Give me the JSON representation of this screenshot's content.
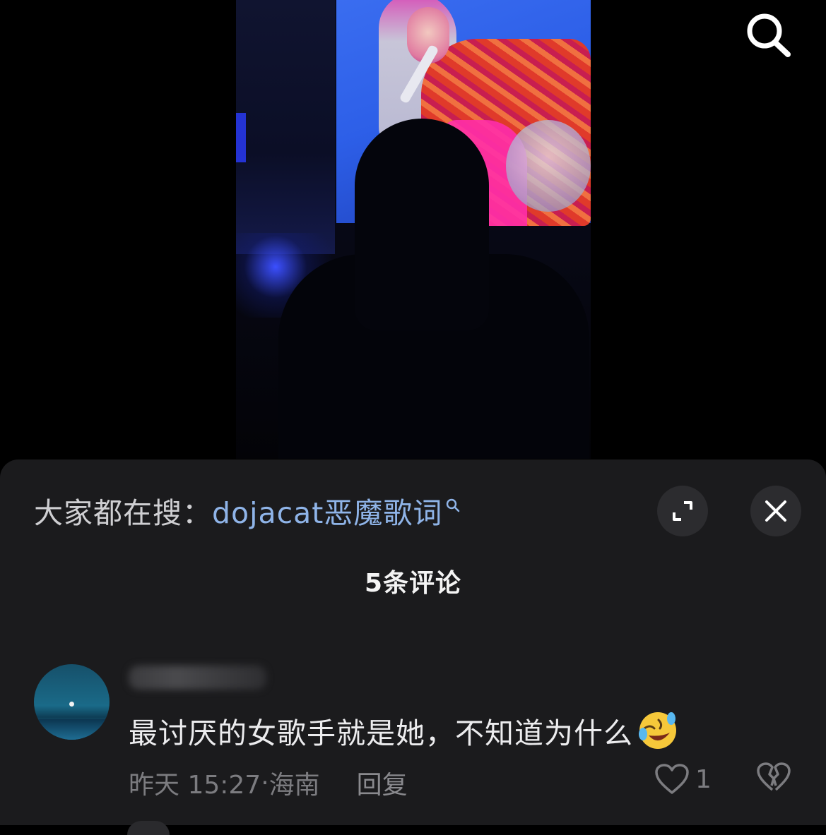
{
  "header": {
    "search_icon": "search-icon"
  },
  "comments_sheet": {
    "suggestion_prefix": "大家都在搜：",
    "suggestion_term": "dojacat恶魔歌词",
    "suggestion_icon": "search-small-icon",
    "expand_icon": "expand-icon",
    "close_icon": "close-icon",
    "count_title": "5条评论"
  },
  "comment": {
    "text": "最讨厌的女歌手就是她，不知道为什么",
    "emoji": "rofl-emoji",
    "time": "昨天 15:27",
    "location_separator": "·",
    "location": "海南",
    "reply_label": "回复",
    "like_count": "1"
  },
  "colors": {
    "sheet_bg": "#1b1b1d",
    "link_blue": "#8fb4e8",
    "muted_text": "#7c7c80"
  }
}
